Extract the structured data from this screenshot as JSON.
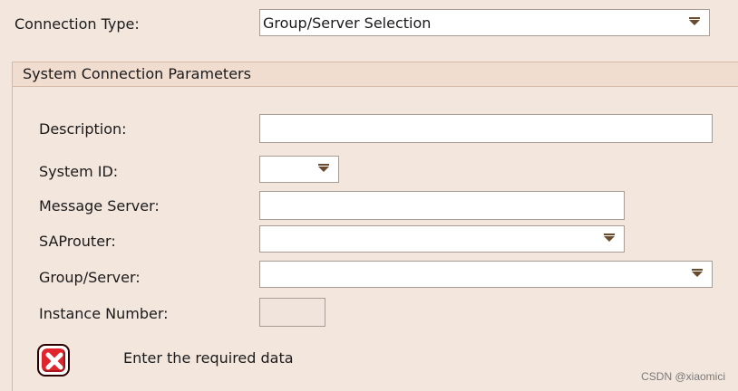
{
  "connection_type": {
    "label": "Connection Type:",
    "selected": "Group/Server Selection"
  },
  "system_connection": {
    "title": "System Connection Parameters",
    "fields": {
      "description": {
        "label": "Description:",
        "value": ""
      },
      "system_id": {
        "label": "System ID:",
        "value": ""
      },
      "message_server": {
        "label": "Message Server:",
        "value": ""
      },
      "saprouter": {
        "label": "SAProuter:",
        "value": ""
      },
      "group_server": {
        "label": "Group/Server:",
        "value": ""
      },
      "instance_number": {
        "label": "Instance Number:",
        "value": ""
      }
    }
  },
  "status": {
    "icon": "error-icon",
    "message": "Enter the required data"
  },
  "watermark": "CSDN @xiaomici",
  "colors": {
    "background": "#f3e6dd",
    "header_background": "#f1ddd0",
    "error_red": "#e0262c",
    "arrow": "#6b4b2e"
  }
}
